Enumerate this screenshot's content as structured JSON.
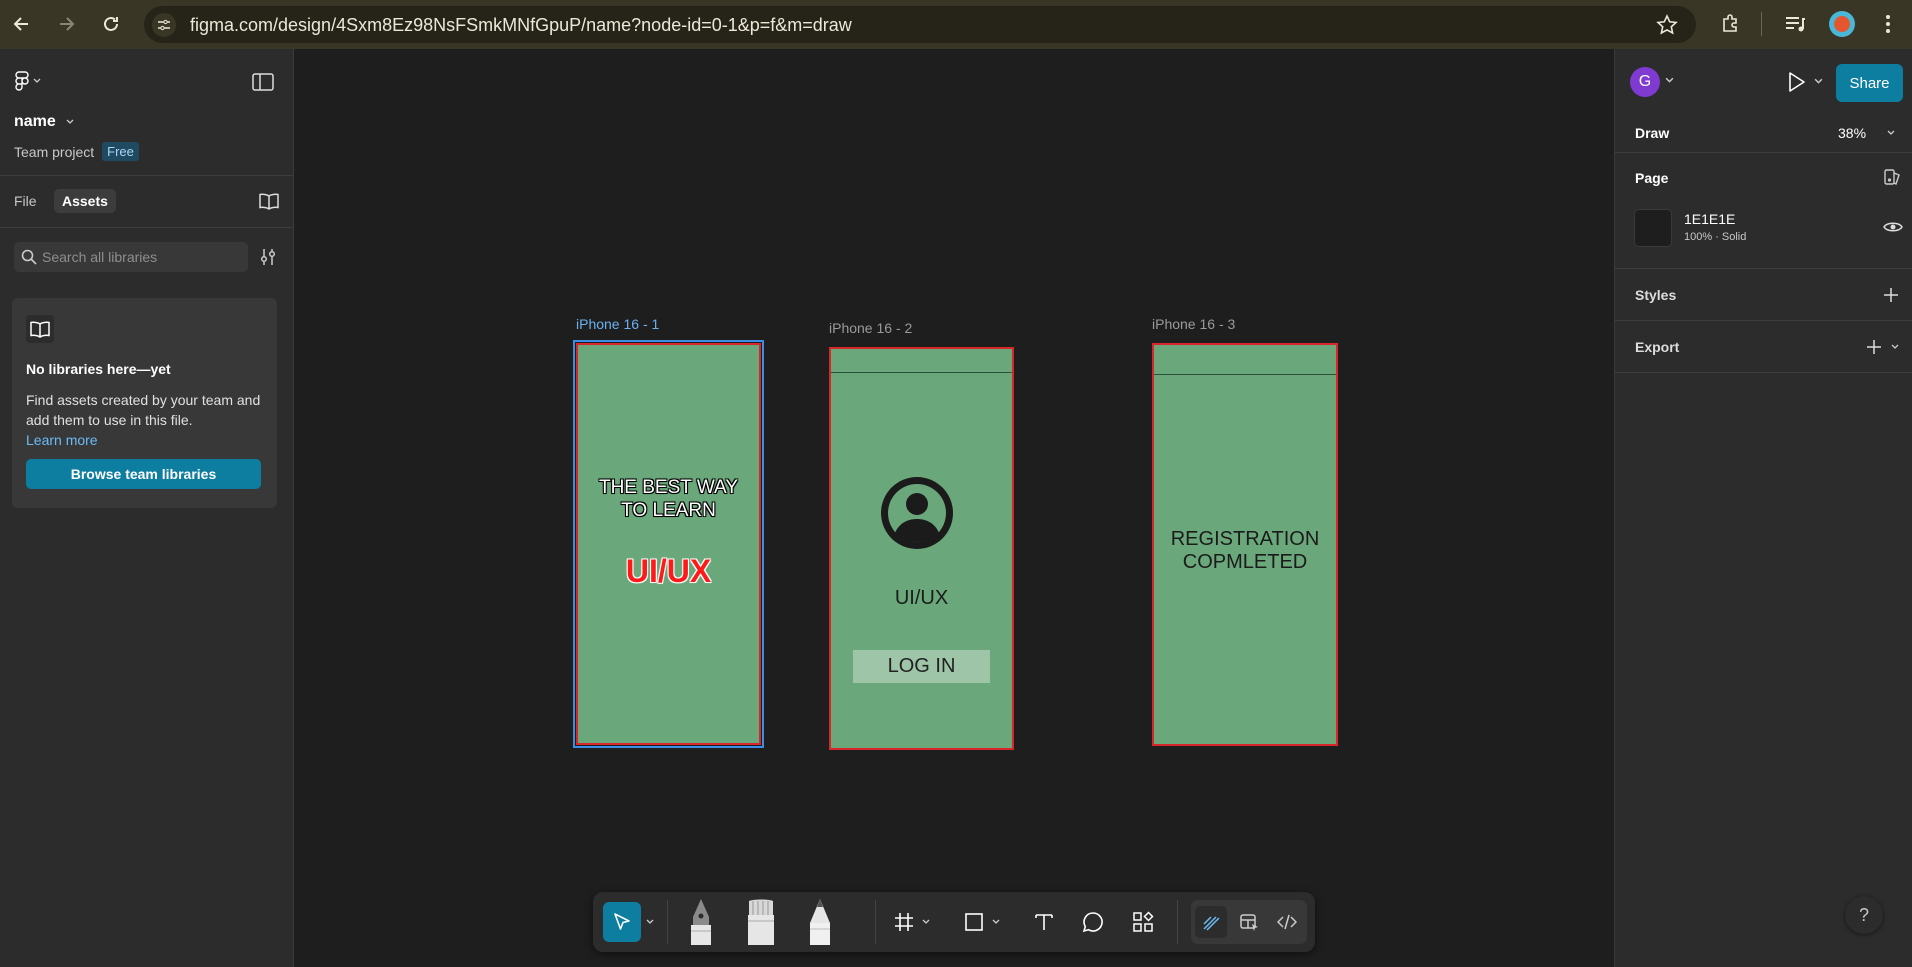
{
  "browser": {
    "url": "figma.com/design/4Sxm8Ez98NsFSmkMNfGpuP/name?node-id=0-1&p=f&m=draw"
  },
  "left_panel": {
    "file_name": "name",
    "team": "Team project",
    "plan_badge": "Free",
    "tabs": [
      "File",
      "Assets"
    ],
    "active_tab": "Assets",
    "search": {
      "placeholder": "Search all libraries",
      "value": ""
    },
    "empty_state": {
      "title": "No libraries here—yet",
      "description": "Find assets created by your team and add them to use in this file.",
      "link": "Learn more",
      "button": "Browse team libraries"
    }
  },
  "canvas": {
    "background": "#1E1E1E",
    "frames": [
      {
        "label": "iPhone 16 - 1",
        "selected": true,
        "headline": [
          "THE BEST WAY",
          "TO LEARN"
        ],
        "highlight": "UI/UX"
      },
      {
        "label": "iPhone 16 - 2",
        "selected": false,
        "app_name": "UI/UX",
        "button": "LOG IN"
      },
      {
        "label": "iPhone 16 - 3",
        "selected": false,
        "message": [
          "REGISTRATION",
          "COPMLETED"
        ]
      }
    ],
    "frame_fill": "#6AA87B",
    "frame_stroke": "#D8262B"
  },
  "toolbar": {
    "tools": [
      "move-tool",
      "pen-tool",
      "brush-tool",
      "pencil-tool",
      "frame-tool",
      "shape-tool",
      "text-tool",
      "comment-tool",
      "actions-tool"
    ],
    "active_tool": "move-tool",
    "modes": [
      "draw-mode",
      "design-mode",
      "dev-mode"
    ],
    "active_mode": "draw-mode"
  },
  "right_panel": {
    "user_initial": "G",
    "share_label": "Share",
    "mode_label": "Draw",
    "zoom": "38%",
    "page_section": {
      "title": "Page",
      "color_hex": "1E1E1E",
      "color_meta": "100% · Solid"
    },
    "styles_title": "Styles",
    "export_title": "Export"
  },
  "help": {
    "label": "?"
  },
  "colors": {
    "accent": "#0D7EA0",
    "avatar": "#7F3AD2",
    "browser_bar": "#3A3626"
  }
}
